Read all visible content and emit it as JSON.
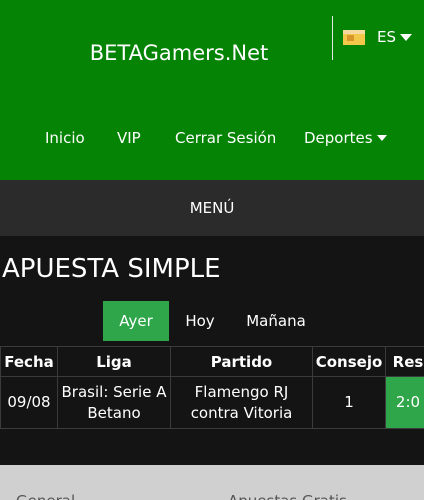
{
  "header": {
    "site_title": "BETAGamers.Net",
    "language": "ES",
    "flag_icon": "spain-flag-icon",
    "nav": [
      "Inicio",
      "VIP",
      "Cerrar Sesión",
      "Deportes"
    ],
    "background_color": "#048304"
  },
  "menu_bar": {
    "label": "MENÚ"
  },
  "main": {
    "title": "APUESTA SIMPLE",
    "day_tabs": [
      {
        "label": "Ayer",
        "active": true
      },
      {
        "label": "Hoy",
        "active": false
      },
      {
        "label": "Mañana",
        "active": false
      }
    ],
    "table": {
      "headers": [
        "Fecha",
        "Liga",
        "Partido",
        "Consejo",
        "Res"
      ],
      "rows": [
        {
          "fecha": "09/08",
          "liga": "Brasil: Serie A Betano",
          "partido": "Flamengo RJ contra Vitoria",
          "consejo": "1",
          "res": "2:0"
        }
      ]
    },
    "accent_color": "#2fa64a"
  },
  "footer_tabs": [
    "General",
    "Apuestas Gratis"
  ]
}
